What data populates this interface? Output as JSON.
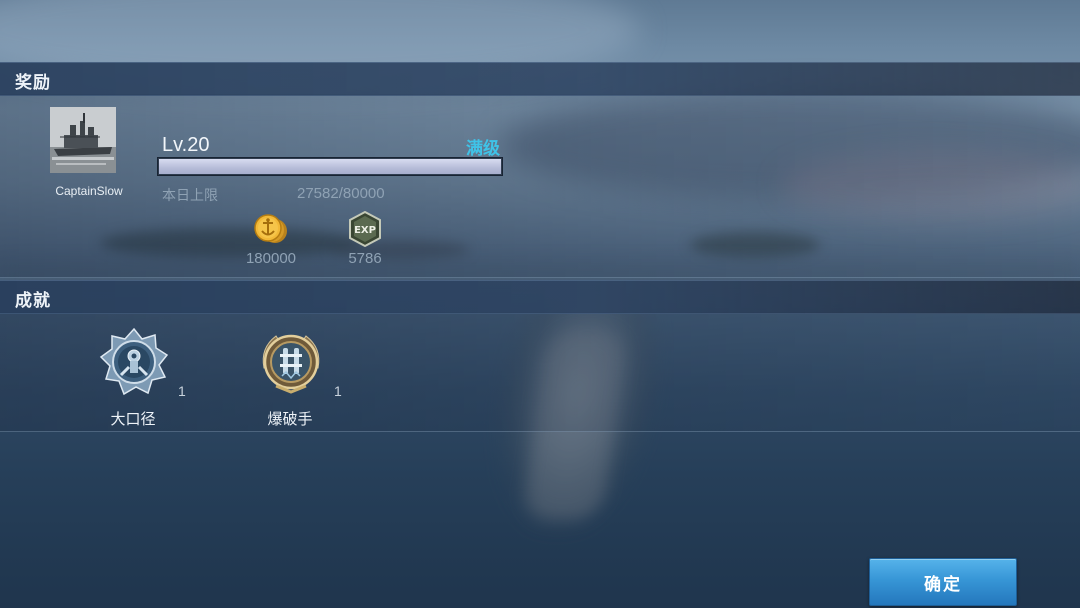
{
  "rewards": {
    "title": "奖励",
    "player": {
      "name": "CaptainSlow",
      "avatar_icon": "battleship-photo-icon"
    },
    "level": {
      "label": "Lv.20",
      "status": "满级",
      "progress_fraction": 1.0
    },
    "daily_limit": {
      "label": "本日上限",
      "value": "27582/80000"
    },
    "items": [
      {
        "icon": "gold-anchor-coin-icon",
        "value": "180000"
      },
      {
        "icon": "exp-badge-icon",
        "value": "5786"
      }
    ]
  },
  "achievements": {
    "title": "成就",
    "badges": [
      {
        "icon": "big-caliber-medal-icon",
        "name": "大口径",
        "count": "1"
      },
      {
        "icon": "demolition-medal-icon",
        "name": "爆破手",
        "count": "1"
      }
    ]
  },
  "confirm_button": {
    "label": "确定"
  },
  "colors": {
    "accent_max_level": "#3fc3e8",
    "button_blue": "#3796d6",
    "header_bar": "#2c4260"
  }
}
